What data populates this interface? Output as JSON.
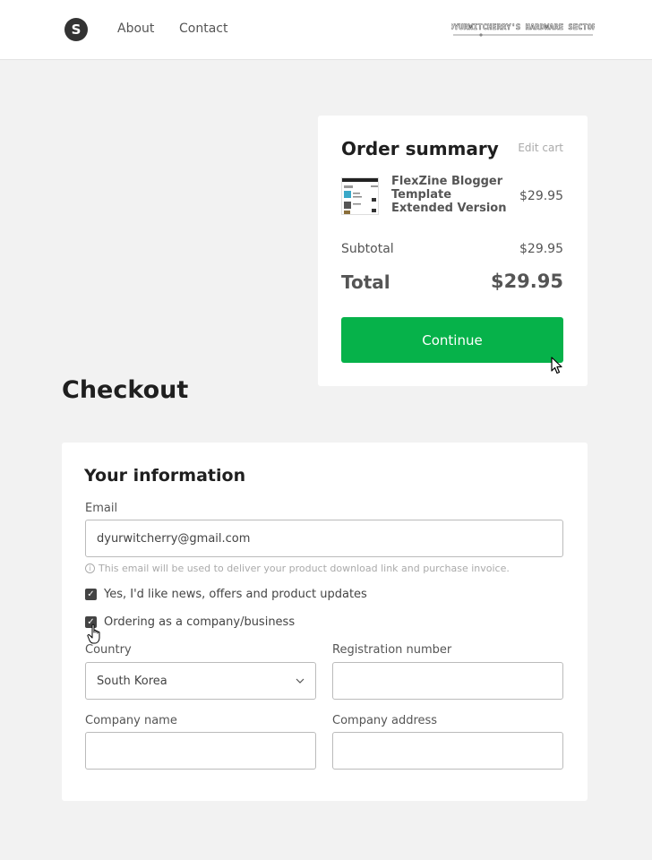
{
  "header": {
    "logo_letter": "S",
    "nav": [
      "About",
      "Contact"
    ],
    "store_title": "DYURWITCHERRY'S HARDWARE SECTOR"
  },
  "summary": {
    "title": "Order summary",
    "edit_cart": "Edit cart",
    "product_name": "FlexZine Blogger Template Extended Version",
    "product_price": "$29.95",
    "subtotal_label": "Subtotal",
    "subtotal_value": "$29.95",
    "total_label": "Total",
    "total_value": "$29.95",
    "continue_label": "Continue"
  },
  "checkout": {
    "title": "Checkout"
  },
  "info": {
    "title": "Your information",
    "email_label": "Email",
    "email_value": "dyurwitcherry@gmail.com",
    "email_hint": "This email will be used to deliver your product download link and purchase invoice.",
    "news_checkbox": "Yes, I'd like news, offers and product updates",
    "company_checkbox": "Ordering as a company/business",
    "country_label": "Country",
    "country_value": "South Korea",
    "reg_label": "Registration number",
    "company_name_label": "Company name",
    "company_address_label": "Company address"
  },
  "colors": {
    "accent": "#06b24a",
    "background": "#f2f2f2"
  }
}
